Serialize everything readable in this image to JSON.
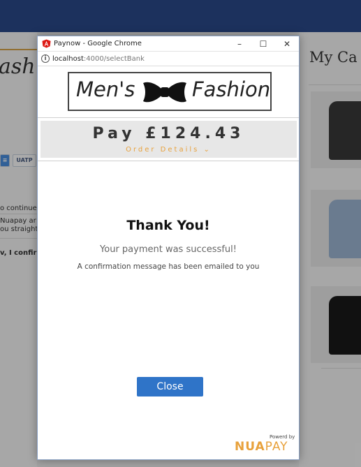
{
  "background": {
    "script_title": "ash",
    "badge": "UATP",
    "texts": [
      "o continue",
      "Nuapay ar",
      "ou straight",
      "v, I confirm"
    ],
    "right_title": "My Ca"
  },
  "window": {
    "title": "Paynow - Google Chrome",
    "controls": {
      "minimize": "–",
      "maximize": "☐",
      "close": "✕"
    },
    "url_host": "localhost",
    "url_rest": ":4000/selectBank"
  },
  "logo": {
    "word1": "Men's",
    "word2": "Fashion"
  },
  "payment": {
    "amount": "Pay £124.43",
    "order_details": "Order Details ⌄"
  },
  "result": {
    "title": "Thank You!",
    "message": "Your payment was successful!",
    "note": "A confirmation message has been emailed to you"
  },
  "close_label": "Close",
  "footer": {
    "powered": "Powerd by",
    "brand_part1": "NUA",
    "brand_part2": "PAY"
  },
  "colors": {
    "accent_orange": "#e8a13b",
    "button_blue": "#2f74c8",
    "topbar_navy": "#2b4a8b"
  }
}
